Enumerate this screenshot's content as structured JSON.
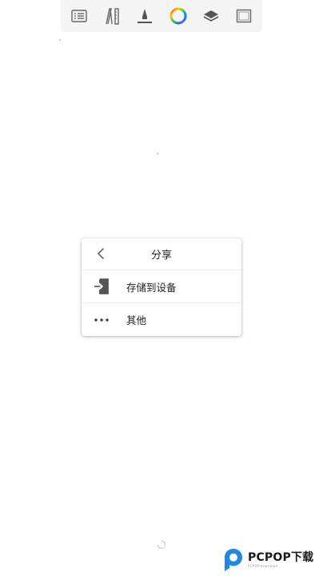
{
  "toolbar": {
    "icons": [
      "list-icon",
      "pencil-ruler-icon",
      "brush-icon",
      "color-wheel-icon",
      "layers-icon",
      "canvas-frame-icon"
    ]
  },
  "dialog": {
    "title": "分享",
    "back_icon": "chevron-left-icon",
    "items": [
      {
        "label": "存储到设备",
        "icon": "save-to-device-icon"
      },
      {
        "label": "其他",
        "icon": "more-dots-icon"
      }
    ]
  },
  "watermark": {
    "text": "PCPOP下载",
    "sub": "PCPOP.download"
  },
  "colors": {
    "toolbar_bg": "#f5f5f5",
    "icon_gray": "#666666",
    "text": "#222222",
    "watermark_blue": "#1e88e5"
  }
}
